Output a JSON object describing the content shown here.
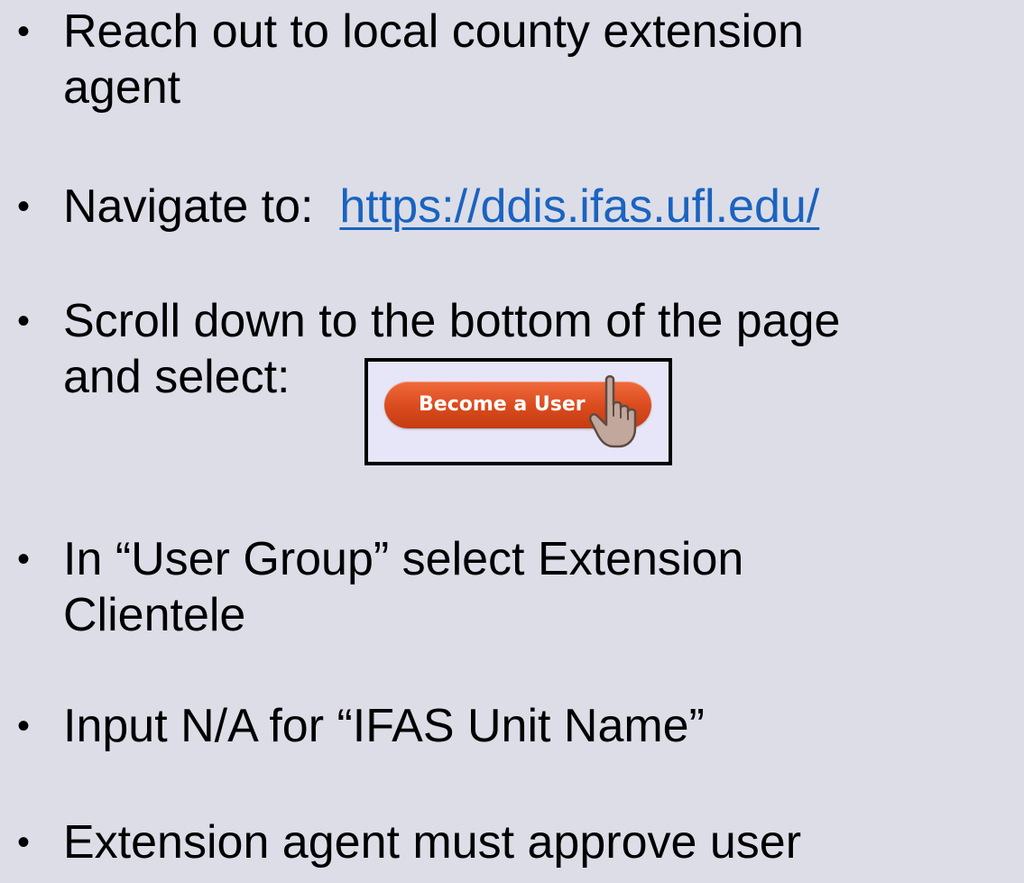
{
  "bullets": [
    {
      "lines": [
        "Reach out to local county extension",
        "agent"
      ]
    },
    {
      "prefix": "Navigate to:  ",
      "link": "https://ddis.ifas.ufl.edu/"
    },
    {
      "lines": [
        "Scroll down to the bottom of the page",
        "and select:"
      ]
    },
    {
      "lines": [
        "In “User Group” select Extension",
        "Clientele"
      ]
    },
    {
      "lines": [
        "Input N/A for “IFAS Unit Name”"
      ]
    },
    {
      "lines": [
        "Extension agent must approve user"
      ]
    }
  ],
  "bullet_symbol": "•",
  "button": {
    "label": "Become a User",
    "icon": "pointer-hand-icon"
  },
  "colors": {
    "background": "#dcdde7",
    "link": "#1a63c0",
    "button": "#d94a1d"
  }
}
